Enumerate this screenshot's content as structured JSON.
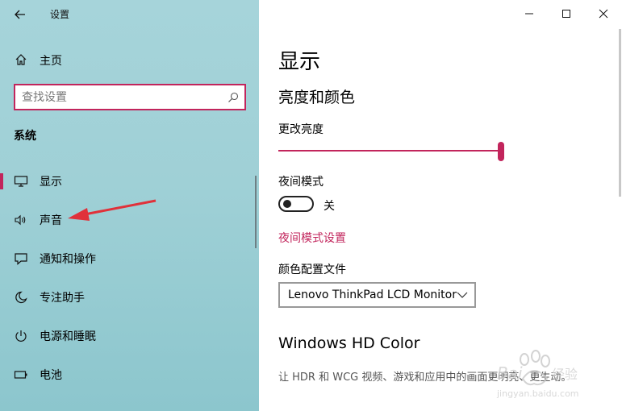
{
  "window": {
    "title": "设置",
    "controls": [
      "minimize",
      "maximize",
      "close"
    ]
  },
  "sidebar": {
    "home_label": "主页",
    "search_placeholder": "查找设置",
    "section_title": "系统",
    "items": [
      {
        "label": "显示",
        "icon": "monitor-icon",
        "active": true
      },
      {
        "label": "声音",
        "icon": "speaker-icon",
        "active": false
      },
      {
        "label": "通知和操作",
        "icon": "notification-icon",
        "active": false
      },
      {
        "label": "专注助手",
        "icon": "moon-icon",
        "active": false
      },
      {
        "label": "电源和睡眠",
        "icon": "power-icon",
        "active": false
      },
      {
        "label": "电池",
        "icon": "battery-icon",
        "active": false
      }
    ]
  },
  "main": {
    "title": "显示",
    "brightness_section": "亮度和颜色",
    "brightness_label": "更改亮度",
    "brightness_value": 1.0,
    "night_mode_label": "夜间模式",
    "night_mode_state": "关",
    "night_mode_settings_link": "夜间模式设置",
    "color_profile_label": "颜色配置文件",
    "color_profile_value": "Lenovo ThinkPad LCD Monitor",
    "hd_color_title": "Windows HD Color",
    "hd_color_desc": "让 HDR 和 WCG 视频、游戏和应用中的画面更明亮、更生动。"
  },
  "colors": {
    "accent": "#c2255c",
    "sidebar_bg": "#a6d4da"
  },
  "watermark": {
    "brand": "Baidu 经验",
    "url": "jingyan.baidu.com"
  }
}
